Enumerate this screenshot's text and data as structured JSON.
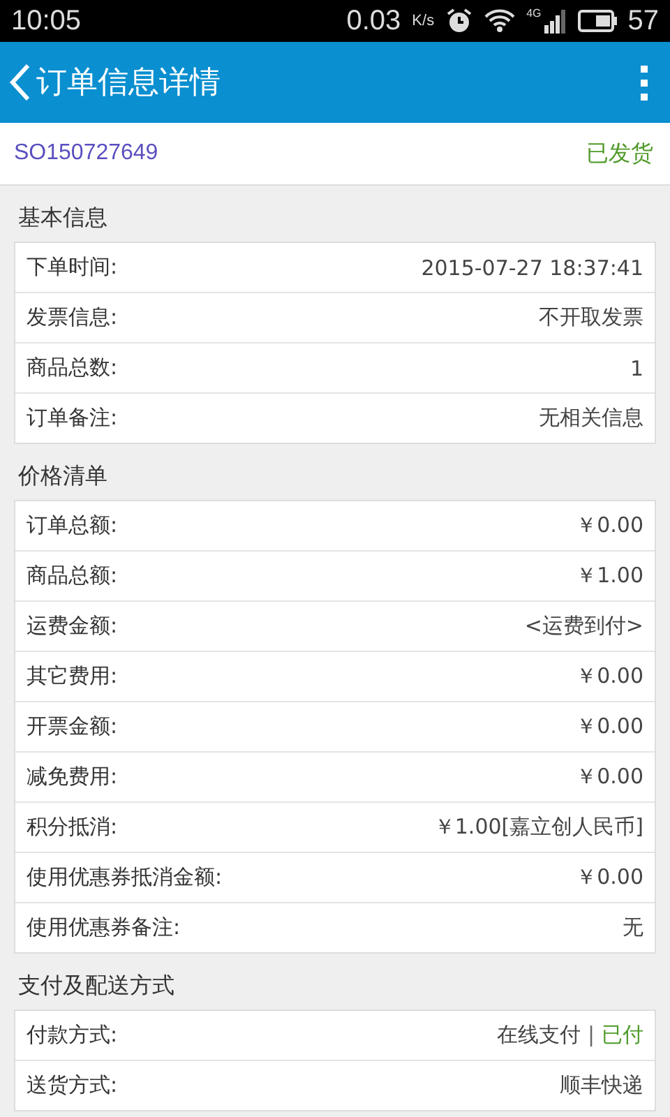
{
  "status_bar": {
    "time": "10:05",
    "speed": "0.03",
    "speed_unit": "K/s",
    "network": "4G",
    "battery": "57"
  },
  "app_bar": {
    "title": "订单信息详情"
  },
  "order": {
    "number": "SO150727649",
    "status": "已发货"
  },
  "sections": [
    {
      "title": "基本信息",
      "rows": [
        {
          "label": "下单时间:",
          "value": "2015-07-27 18:37:41"
        },
        {
          "label": "发票信息:",
          "value": "不开取发票"
        },
        {
          "label": "商品总数:",
          "value": "1"
        },
        {
          "label": "订单备注:",
          "value": "无相关信息"
        }
      ]
    },
    {
      "title": "价格清单",
      "rows": [
        {
          "label": "订单总额:",
          "value": "￥0.00"
        },
        {
          "label": "商品总额:",
          "value": "￥1.00"
        },
        {
          "label": "运费金额:",
          "value": "<运费到付>"
        },
        {
          "label": "其它费用:",
          "value": "￥0.00"
        },
        {
          "label": "开票金额:",
          "value": "￥0.00"
        },
        {
          "label": "减免费用:",
          "value": "￥0.00"
        },
        {
          "label": "积分抵消:",
          "value": "￥1.00[嘉立创人民币]"
        },
        {
          "label": "使用优惠券抵消金额:",
          "value": "￥0.00"
        },
        {
          "label": "使用优惠券备注:",
          "value": "无"
        }
      ]
    },
    {
      "title": "支付及配送方式",
      "rows": [
        {
          "label": "付款方式:",
          "value": "在线支付",
          "separator": "|",
          "status": "已付"
        },
        {
          "label": "送货方式:",
          "value": "顺丰快递"
        }
      ]
    }
  ]
}
